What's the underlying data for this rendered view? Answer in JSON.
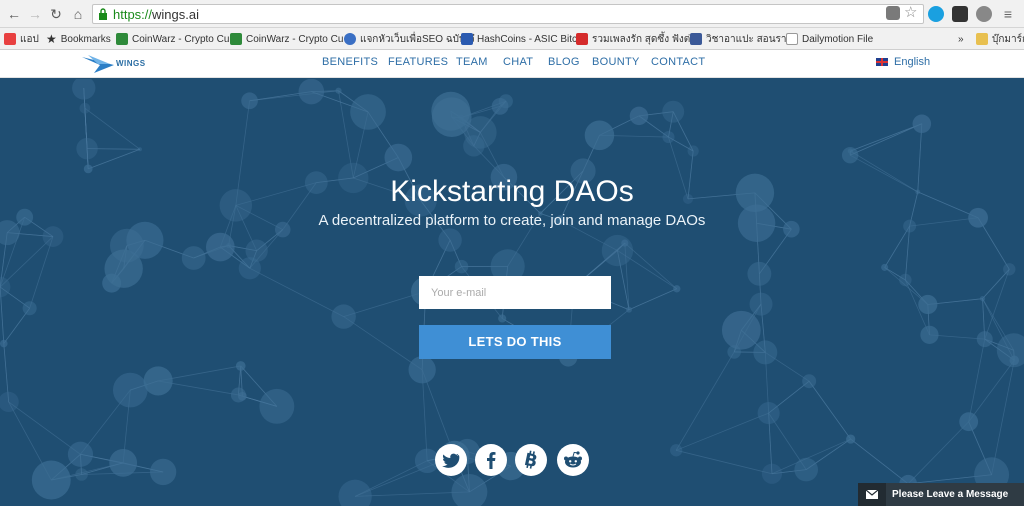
{
  "browser": {
    "url_scheme": "https://",
    "url_host": "wings.ai",
    "bookmarks": [
      {
        "label": "แอป",
        "color": "#e84040"
      },
      {
        "label": "Bookmarks",
        "color": "#444444"
      },
      {
        "label": "CoinWarz - Crypto Cu",
        "color": "#2e8a3a"
      },
      {
        "label": "CoinWarz - Crypto Cu",
        "color": "#2e8a3a"
      },
      {
        "label": "แจกหัวเว็บเพื่อSEO ฉบับเจ๋",
        "color": "#3a6fc4"
      },
      {
        "label": "HashCoins - ASIC Bitc",
        "color": "#2a5ab0"
      },
      {
        "label": "รวมเพลงรัก สุดซึ้ง ฟังต่อเ",
        "color": "#d52b2b"
      },
      {
        "label": "วิชาอาแปะ สอนราย",
        "color": "#3b5998"
      },
      {
        "label": "Dailymotion File",
        "color": "#bbbbbb"
      }
    ],
    "overflow": "»",
    "other_bookmarks": "บุ๊กมาร์กอื่"
  },
  "site_nav": {
    "logo_text": "WINGS",
    "links": [
      "BENEFITS",
      "FEATURES",
      "TEAM",
      "CHAT",
      "BLOG",
      "BOUNTY",
      "CONTACT"
    ],
    "language": "English"
  },
  "hero": {
    "title": "Kickstarting DAOs",
    "subtitle": "A decentralized platform to create, join and manage DAOs",
    "email_placeholder": "Your e-mail",
    "cta_label": "LETS DO THIS"
  },
  "social": [
    "twitter-icon",
    "facebook-icon",
    "bitcoin-icon",
    "reddit-icon"
  ],
  "chat_widget": {
    "label": "Please Leave a Message"
  },
  "colors": {
    "hero_bg": "#1f4e72",
    "cta_bg": "#3f8fd5",
    "nav_link": "#2e6ea6"
  }
}
